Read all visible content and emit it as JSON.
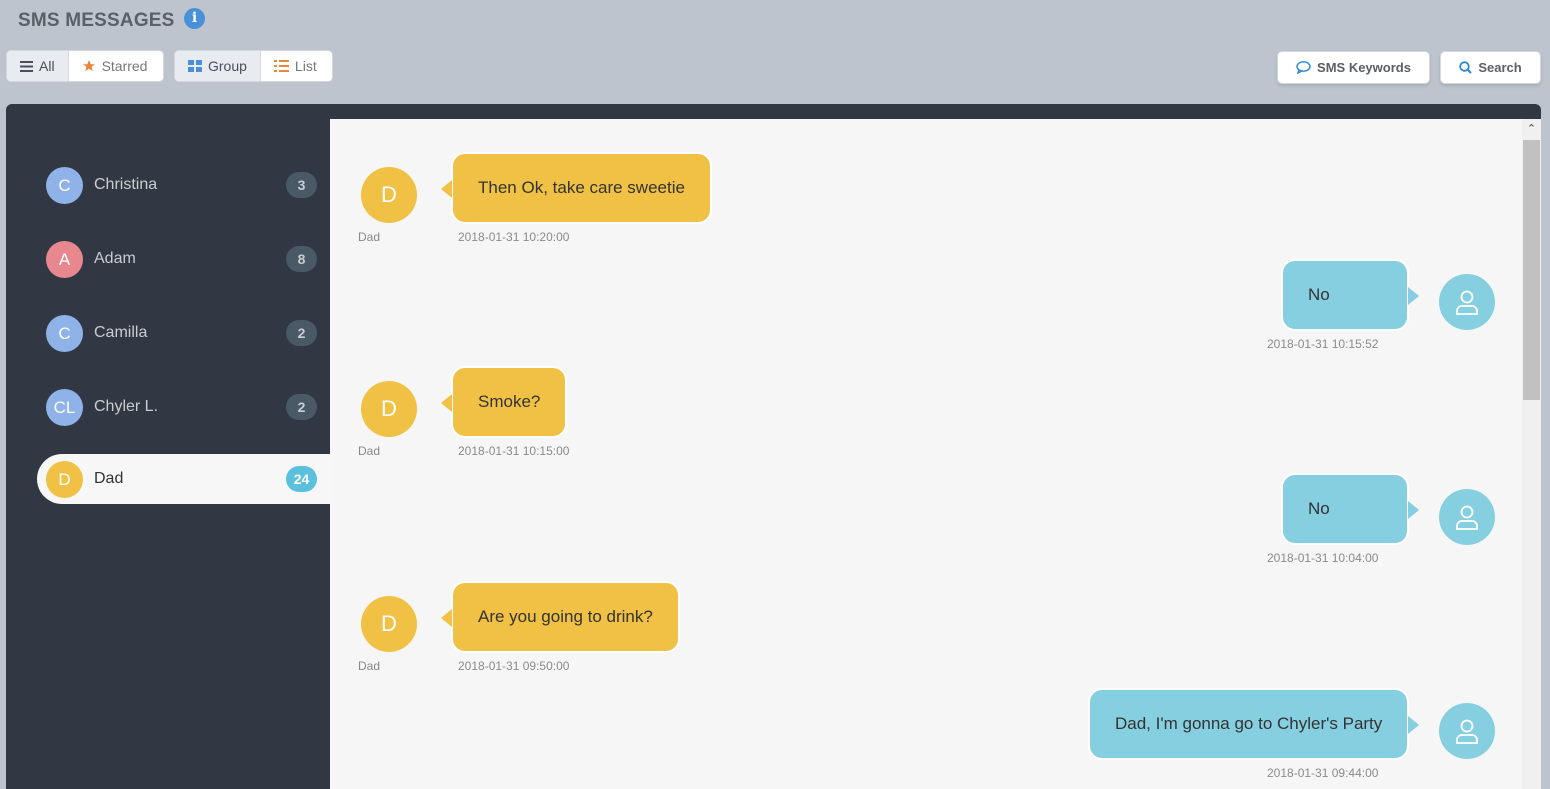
{
  "header": {
    "title": "SMS MESSAGES",
    "info_icon": "info-icon"
  },
  "filters": {
    "all": "All",
    "starred": "Starred",
    "group": "Group",
    "list": "List"
  },
  "toolbar": {
    "keywords": "SMS Keywords",
    "search": "Search"
  },
  "contacts": [
    {
      "initials": "C",
      "name": "Christina",
      "count": "3",
      "color": "#8fb3e8"
    },
    {
      "initials": "A",
      "name": "Adam",
      "count": "8",
      "color": "#e8888e"
    },
    {
      "initials": "C",
      "name": "Camilla",
      "count": "2",
      "color": "#8fb3e8"
    },
    {
      "initials": "CL",
      "name": "Chyler L.",
      "count": "2",
      "color": "#8fb3e8"
    },
    {
      "initials": "D",
      "name": "Dad",
      "count": "24",
      "color": "#f0c145",
      "selected": true
    }
  ],
  "messages": [
    {
      "direction": "in",
      "initials": "D",
      "sender": "Dad",
      "text": "Then Ok, take care sweetie",
      "time": "2018-01-31 10:20:00"
    },
    {
      "direction": "out",
      "text": "No",
      "time": "2018-01-31 10:15:52"
    },
    {
      "direction": "in",
      "initials": "D",
      "sender": "Dad",
      "text": "Smoke?",
      "time": "2018-01-31 10:15:00"
    },
    {
      "direction": "out",
      "text": "No",
      "time": "2018-01-31 10:04:00"
    },
    {
      "direction": "in",
      "initials": "D",
      "sender": "Dad",
      "text": "Are you going to drink?",
      "time": "2018-01-31 09:50:00"
    },
    {
      "direction": "out",
      "text": "Dad, I'm gonna go to Chyler's Party",
      "time": "2018-01-31 09:44:00"
    }
  ],
  "colors": {
    "incoming": "#f0c145",
    "outgoing": "#86cfe0",
    "sidebar": "#323843",
    "badge_active": "#5bc0de"
  }
}
